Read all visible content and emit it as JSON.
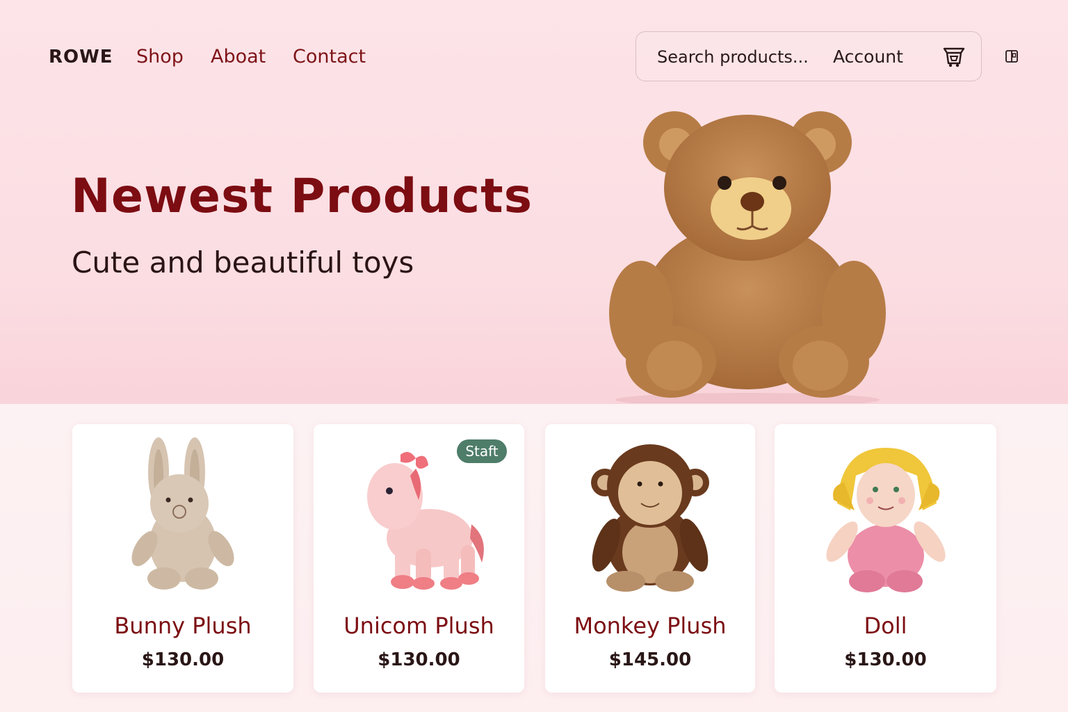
{
  "header": {
    "brand": "ROWE",
    "nav": [
      {
        "label": "Shop"
      },
      {
        "label": "Aboat"
      },
      {
        "label": "Contact"
      }
    ],
    "search": {
      "placeholder": "Search products..."
    },
    "account_label": "Account",
    "cart_icon": "cart-icon",
    "menu_icon": "menu-icon"
  },
  "hero": {
    "title": "Newest Products",
    "subtitle": "Cute and beautiful toys",
    "image": "teddy-bear"
  },
  "products": [
    {
      "name": "Bunny Plush",
      "price": "$130.00",
      "image": "bunny-plush"
    },
    {
      "name": "Unicom Plush",
      "price": "$130.00",
      "image": "unicorn-plush",
      "badge": "Staft"
    },
    {
      "name": "Monkey Plush",
      "price": "$145.00",
      "image": "monkey-plush"
    },
    {
      "name": "Doll",
      "price": "$130.00",
      "image": "doll"
    }
  ],
  "colors": {
    "accent": "#7c0d12",
    "hero_bg": "#fbdde2",
    "badge_bg": "#4e7d6a"
  }
}
